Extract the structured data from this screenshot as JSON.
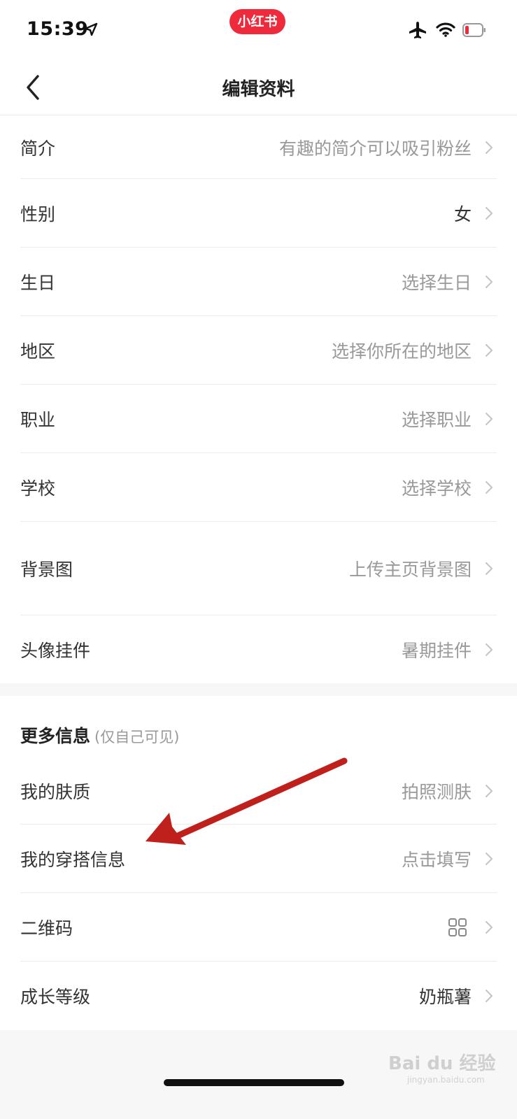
{
  "status_bar": {
    "time": "15:39",
    "app_badge": "小红书",
    "icons": [
      "location-arrow-icon",
      "airplane-icon",
      "wifi-icon",
      "battery-low-icon"
    ],
    "accent_color": "#ee2a3c"
  },
  "header": {
    "title": "编辑资料",
    "back_icon": "chevron-left-icon"
  },
  "profile_rows": [
    {
      "label": "简介",
      "value": "有趣的简介可以吸引粉丝"
    },
    {
      "label": "性别",
      "value": "女"
    },
    {
      "label": "生日",
      "value": "选择生日"
    },
    {
      "label": "地区",
      "value": "选择你所在的地区"
    },
    {
      "label": "职业",
      "value": "选择职业"
    },
    {
      "label": "学校",
      "value": "选择学校"
    },
    {
      "label": "背景图",
      "value": "上传主页背景图"
    },
    {
      "label": "头像挂件",
      "value": "暑期挂件"
    }
  ],
  "more_info": {
    "title": "更多信息",
    "note": "(仅自己可见)",
    "rows": [
      {
        "label": "我的肤质",
        "value": "拍照测肤"
      },
      {
        "label": "我的穿搭信息",
        "value": "点击填写"
      },
      {
        "label": "二维码",
        "icon": "qr-grid-icon"
      },
      {
        "label": "成长等级",
        "value": "奶瓶薯"
      }
    ]
  },
  "annotation": {
    "type": "arrow",
    "color": "#c0201c",
    "points_to": "我的穿搭信息"
  },
  "watermark": {
    "text": "Bai du 经验",
    "sub": "jingyan.baidu.com"
  }
}
